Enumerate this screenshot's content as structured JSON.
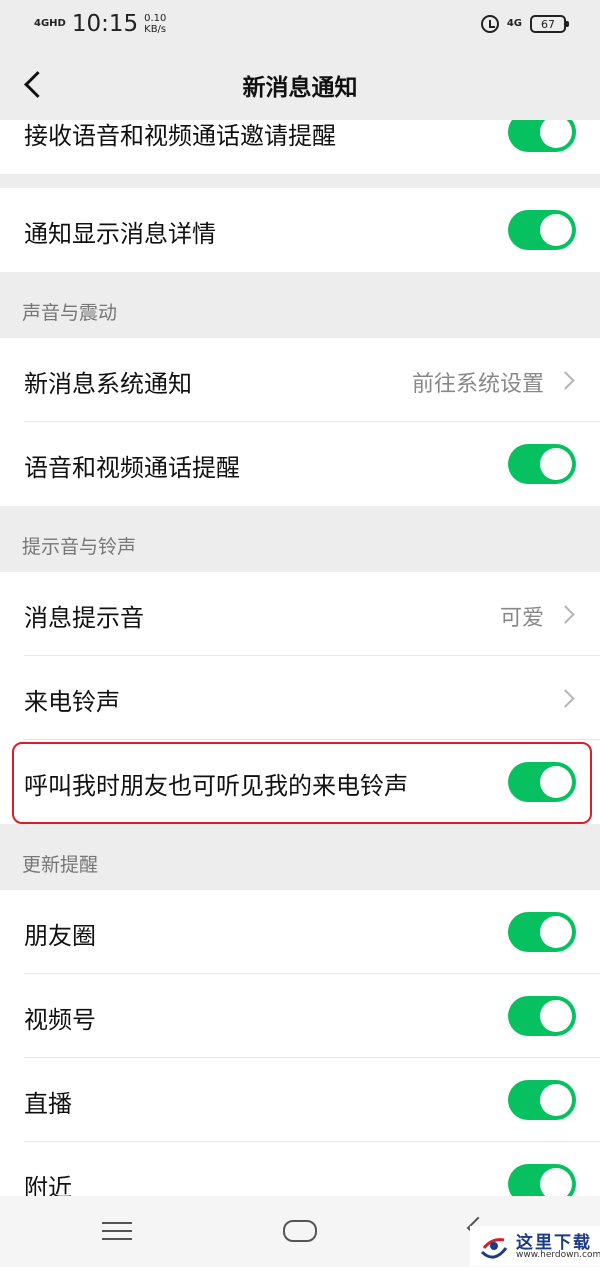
{
  "status_bar": {
    "network": "4GHD",
    "time": "10:15",
    "speed_value": "0.10",
    "speed_unit": "KB/s",
    "network_right": "4G",
    "battery": "67"
  },
  "nav": {
    "title": "新消息通知"
  },
  "rows": {
    "call_invite": {
      "label": "接收语音和视频通话邀请提醒",
      "on": true
    },
    "show_details": {
      "label": "通知显示消息详情",
      "on": true
    },
    "system_notify": {
      "label": "新消息系统通知",
      "value": "前往系统设置"
    },
    "call_reminder": {
      "label": "语音和视频通话提醒",
      "on": true
    },
    "message_tone": {
      "label": "消息提示音",
      "value": "可爱"
    },
    "ringtone": {
      "label": "来电铃声"
    },
    "friends_hear": {
      "label": "呼叫我时朋友也可听见我的来电铃声",
      "on": true
    },
    "moments": {
      "label": "朋友圈",
      "on": true
    },
    "channels": {
      "label": "视频号",
      "on": true
    },
    "live": {
      "label": "直播",
      "on": true
    },
    "nearby": {
      "label": "附近",
      "on": true
    }
  },
  "sections": {
    "sound_vibration": "声音与震动",
    "tones": "提示音与铃声",
    "updates": "更新提醒"
  },
  "colors": {
    "toggle_on": "#07c160",
    "highlight_border": "#d81e2a"
  },
  "watermark": {
    "text": "这里下载",
    "url": "www.herdown.com"
  }
}
